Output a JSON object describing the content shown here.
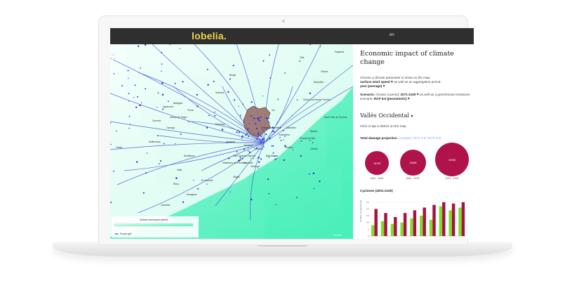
{
  "brand": {
    "logo_text": "lobelia."
  },
  "nav": {
    "lang": "en"
  },
  "panel": {
    "title": "Economic impact of climate change",
    "intro_pre": "Choose a climate parameter to show on the map:",
    "parameter": "surface wind speed",
    "intro_mid": "as well as an aggregation period:",
    "aggregation": "year (average)",
    "scenario_label": "Scenario:",
    "scenario_pre": "choose a period:",
    "period": "2071-2100",
    "scenario_mid": "as well as a greenhouse-emissions scenario:",
    "scenario": "RCP 8.5 (pessimistic)",
    "district": "Vallès Occidental",
    "district_hint": "Click or tap a district on the map.",
    "damage_label": "Total damage projection",
    "damage_compare": "(compare: RCP 4.5 | RCP 8.5)",
    "damage_circles": [
      {
        "value": "167M",
        "period": "2011 - 2040"
      },
      {
        "value": "194M",
        "period": "2041 - 2070"
      },
      {
        "value": "300M",
        "period": "2071 - 2100"
      }
    ],
    "cyclones_label": "Cyclones (2001-2100)",
    "cyclones_ylabel": "Number of cyclones (#)"
  },
  "chart_data": {
    "type": "bar",
    "title": "Cyclones (2001-2100)",
    "ylabel": "Number of cyclones (#)",
    "yticks": [
      "25",
      "20",
      "15",
      "10",
      "5",
      "0"
    ],
    "ylim": [
      0,
      28
    ],
    "categories": [
      "1",
      "2",
      "3",
      "4",
      "5",
      "6",
      "7",
      "8",
      "9",
      "10"
    ],
    "series": [
      {
        "color": "#7fdc2a",
        "values": [
          8,
          11,
          9,
          10,
          13,
          15,
          12,
          22,
          19,
          21
        ]
      },
      {
        "color": "#a9123f",
        "values": [
          20,
          17,
          14,
          17,
          19,
          21,
          23,
          25,
          24,
          25
        ]
      }
    ]
  },
  "map": {
    "places": [
      "Lleida",
      "Barcelona",
      "Girona",
      "Manresa",
      "Sabadell",
      "Terrassa",
      "Mataró",
      "Vic",
      "Igualada",
      "Reus",
      "Tarragona",
      "Cambrils",
      "Valls",
      "Montblanc",
      "Tàrrega",
      "Cervera",
      "Balaguer",
      "Mollerussa",
      "Olot",
      "Figueres",
      "Sant Feliu de Guíxols",
      "Blanes",
      "Santa Coloma de Farners",
      "Berga",
      "Solsona",
      "Granollers",
      "Vilafranca del Penedès",
      "Sant Sadurní d'Anoia",
      "Martorell",
      "El Vendrell",
      "Caldes de Montbui",
      "Cardedeu",
      "Calella",
      "Pineda de Mar",
      "Banyoles",
      "Artesa de Segre",
      "Agramunt",
      "Ponts",
      "Vilanova",
      "Sitges"
    ],
    "legend_title": "Surface wind speed (km/h)",
    "legend_grid": "Power grid",
    "watermark": "lobelia",
    "colors": {
      "sea": "#5ef3c2",
      "land": "#ffffff",
      "grid": "#3c4fd8",
      "district": "#9a6f6f"
    }
  }
}
